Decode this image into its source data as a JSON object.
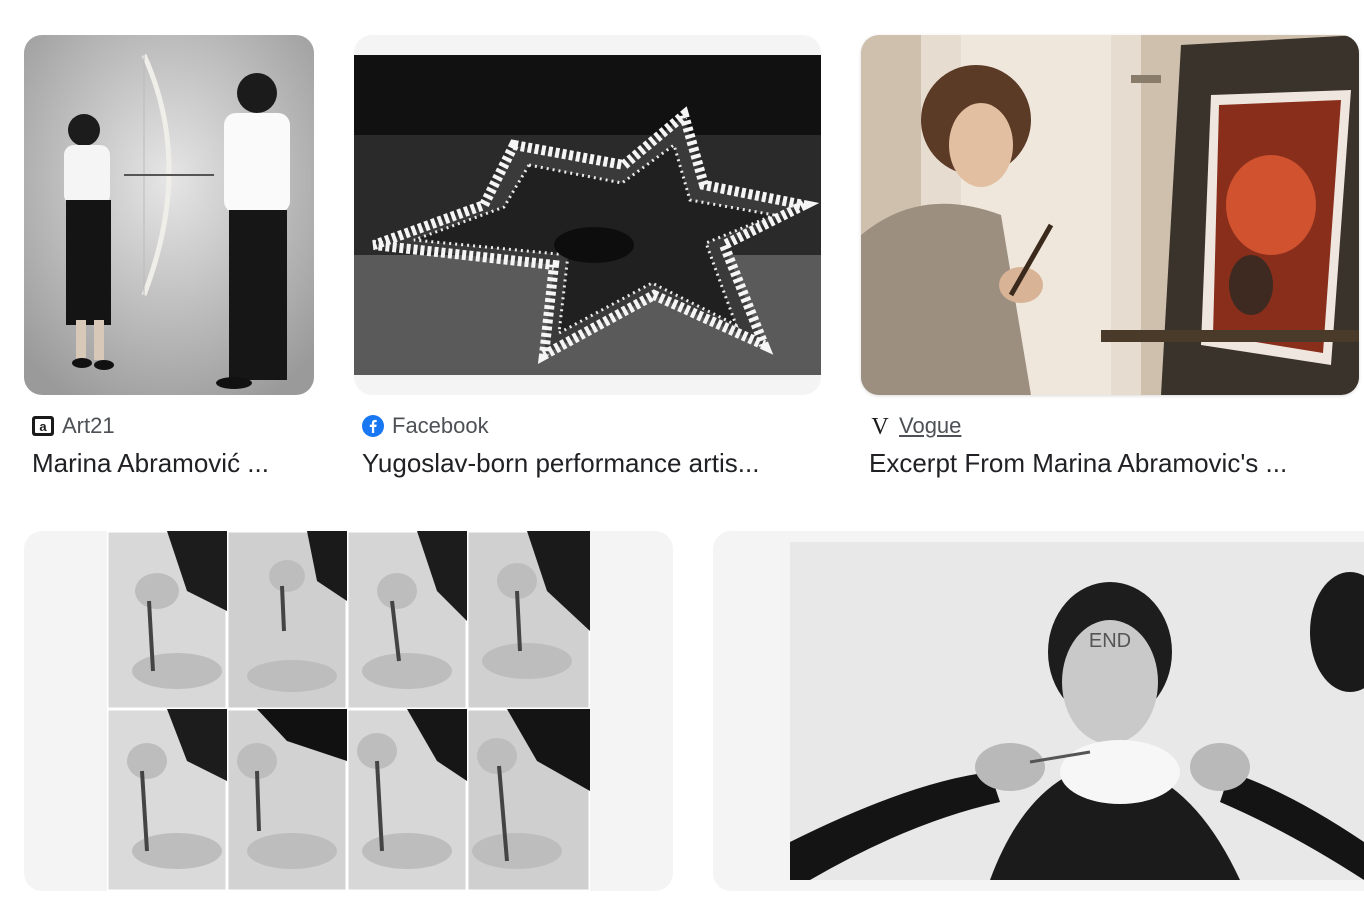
{
  "results": [
    {
      "source": "Art21",
      "favicon_icon": "art21-icon",
      "title": "Marina Abramović ...",
      "image_alt": "Black and white photo of a woman and a man holding a drawn bow and arrow pointed at her"
    },
    {
      "source": "Facebook",
      "favicon_icon": "facebook-icon",
      "title": "Yugoslav-born performance artis...",
      "image_alt": "Black and white photo of a burning star shape on a floor"
    },
    {
      "source": "Vogue",
      "favicon_icon": "vogue-icon",
      "title": "Excerpt From Marina Abramovic's ...",
      "image_alt": "Woman painting a red flower canvas on an easel"
    },
    {
      "image_alt": "Grid of eight black and white photos of a hand with knives stabbing between fingers"
    },
    {
      "image_alt": "Black and white photo of a woman with END written on forehead, smoking, hands holding a cigarette to her face"
    }
  ],
  "colors": {
    "facebook_blue": "#1877f2",
    "text_primary": "#202124",
    "text_secondary": "#4d5156",
    "thumb_bg": "#f4f4f4"
  }
}
